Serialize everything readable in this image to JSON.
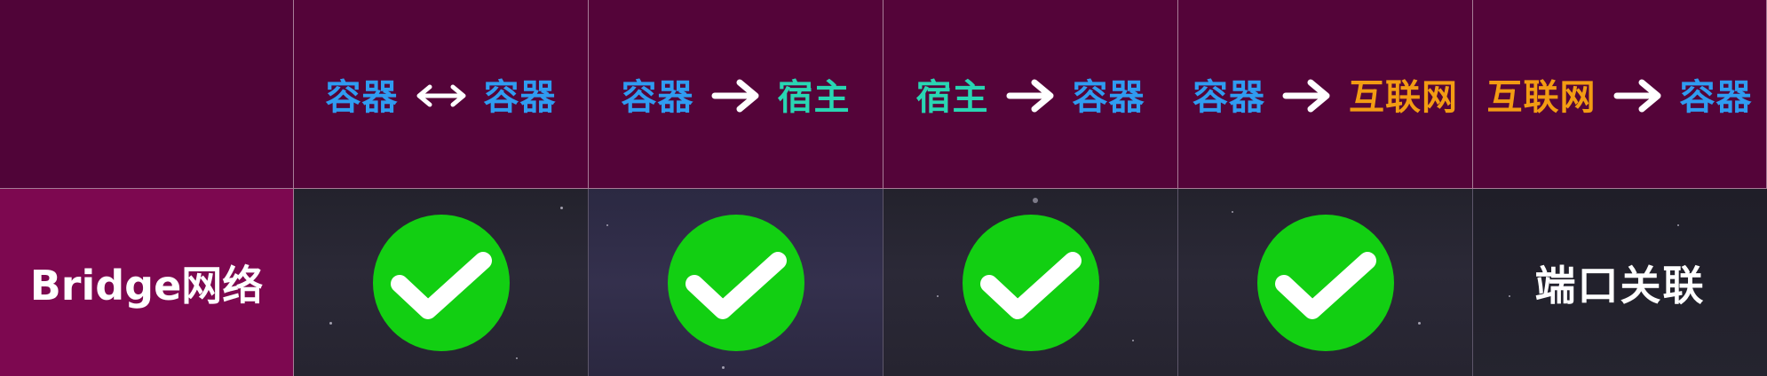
{
  "colors": {
    "container": "#2f9cf1",
    "host": "#29d6b3",
    "internet": "#f39c13",
    "check": "#12cf12",
    "header_bg": "#540439",
    "row_label_bg": "#7d0850"
  },
  "header": {
    "columns": [
      {
        "from": "容器",
        "to": "容器",
        "arrow": "double-arrow-icon"
      },
      {
        "from": "容器",
        "to": "宿主",
        "arrow": "right-arrow-icon"
      },
      {
        "from": "宿主",
        "to": "容器",
        "arrow": "right-arrow-icon"
      },
      {
        "from": "容器",
        "to": "互联网",
        "arrow": "right-arrow-icon"
      },
      {
        "from": "互联网",
        "to": "容器",
        "arrow": "right-arrow-icon"
      }
    ]
  },
  "row": {
    "label": "Bridge网络",
    "cells": [
      {
        "type": "check-icon"
      },
      {
        "type": "check-icon"
      },
      {
        "type": "check-icon"
      },
      {
        "type": "check-icon"
      },
      {
        "type": "text",
        "text": "端口关联"
      }
    ]
  }
}
